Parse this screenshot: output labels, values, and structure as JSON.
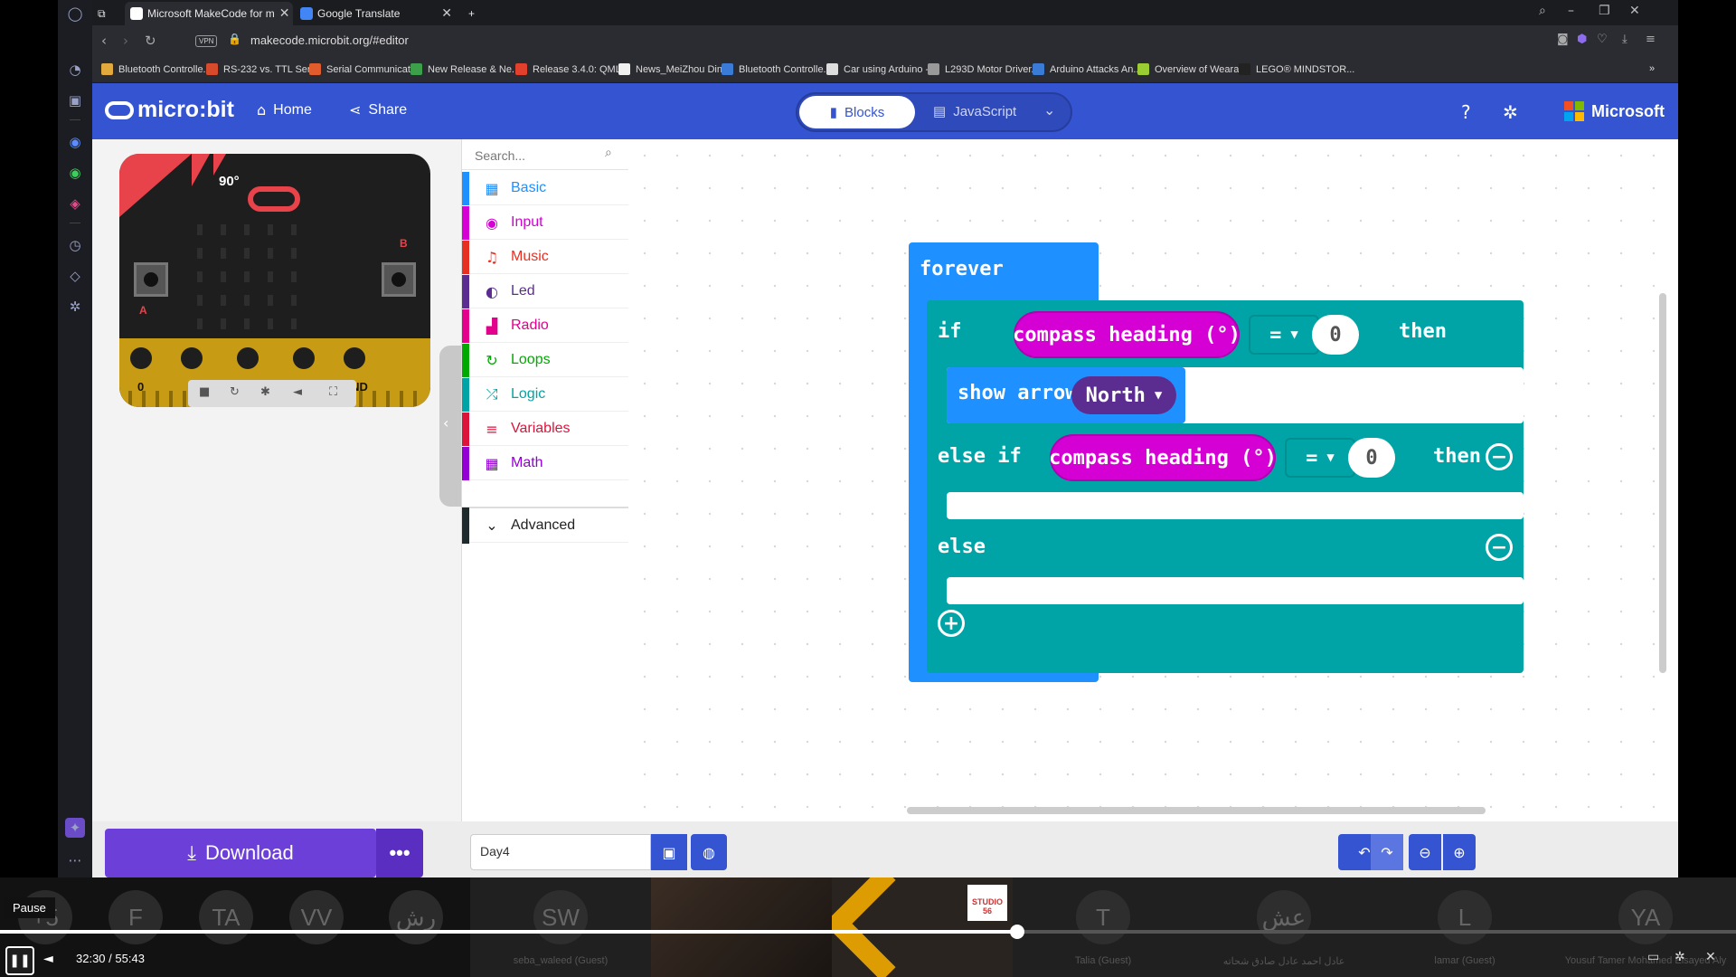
{
  "browser": {
    "tabs": [
      {
        "title": "Microsoft MakeCode for m",
        "active": true
      },
      {
        "title": "Google Translate",
        "active": false
      }
    ],
    "url": "makecode.microbit.org/#editor",
    "vpn_label": "VPN",
    "bookmarks": [
      "Bluetooth Controlle...",
      "RS-232 vs. TTL Seri...",
      "Serial Communicati...",
      "New Release & Ne...",
      "Release 3.4.0: QML...",
      "News_MeiZhou Din...",
      "Bluetooth Controlle...",
      "Car using Arduino -...",
      "L293D Motor Driver...",
      "Arduino Attacks An...",
      "Overview of Weara...",
      "LEGO® MINDSTOR..."
    ]
  },
  "makecode": {
    "logo": "micro:bit",
    "home_label": "Home",
    "share_label": "Share",
    "blocks_label": "Blocks",
    "javascript_label": "JavaScript",
    "brand": "Microsoft"
  },
  "simulator": {
    "heading_value": "90°",
    "button_a": "A",
    "button_b": "B",
    "pins": [
      "0",
      "1",
      "2",
      "3V",
      "GND"
    ]
  },
  "toolbox": {
    "search_placeholder": "Search...",
    "categories": [
      {
        "label": "Basic",
        "color": "#1e90ff"
      },
      {
        "label": "Input",
        "color": "#d400d4"
      },
      {
        "label": "Music",
        "color": "#e63022"
      },
      {
        "label": "Led",
        "color": "#5c2d91"
      },
      {
        "label": "Radio",
        "color": "#e3008c"
      },
      {
        "label": "Loops",
        "color": "#00aa00"
      },
      {
        "label": "Logic",
        "color": "#00a4a6"
      },
      {
        "label": "Variables",
        "color": "#dc143c"
      },
      {
        "label": "Math",
        "color": "#9400d3"
      }
    ],
    "advanced_label": "Advanced"
  },
  "workspace": {
    "forever": "forever",
    "if": "if",
    "compass1": "compass heading (°)",
    "op1": "=",
    "val1": "0",
    "then1": "then",
    "show_arrow": "show arrow",
    "direction": "North",
    "else_if": "else if",
    "compass2": "compass heading (°)",
    "op2": "=",
    "val2": "0",
    "then2": "then",
    "else": "else"
  },
  "bottombar": {
    "download_label": "Download",
    "project_name": "Day4"
  },
  "meeting": {
    "participants": [
      {
        "initials": "+5",
        "name": ""
      },
      {
        "initials": "F",
        "name": ""
      },
      {
        "initials": "TA",
        "name": ""
      },
      {
        "initials": "VV",
        "name": ""
      },
      {
        "initials": "رش",
        "name": ""
      },
      {
        "initials": "SW",
        "name": "seba_waleed (Guest)"
      },
      {
        "initials": "T",
        "name": "Talia (Guest)"
      },
      {
        "initials": "عش",
        "name": "عادل احمد عادل صادق شحاته"
      },
      {
        "initials": "L",
        "name": "lamar (Guest)"
      },
      {
        "initials": "YA",
        "name": "Yousuf Tamer Mohamed Elsayed Aly"
      }
    ],
    "logo_label": "STUDIO 56",
    "time_current": "32:30",
    "time_total": "55:43",
    "progress": 0.5857,
    "tooltip": "Pause"
  },
  "colors": {
    "header": "#3454d1",
    "loops_block": "#1e90ff",
    "logic_block": "#00a4a6",
    "input_block": "#d400d4",
    "download": "#6d3fd9"
  }
}
